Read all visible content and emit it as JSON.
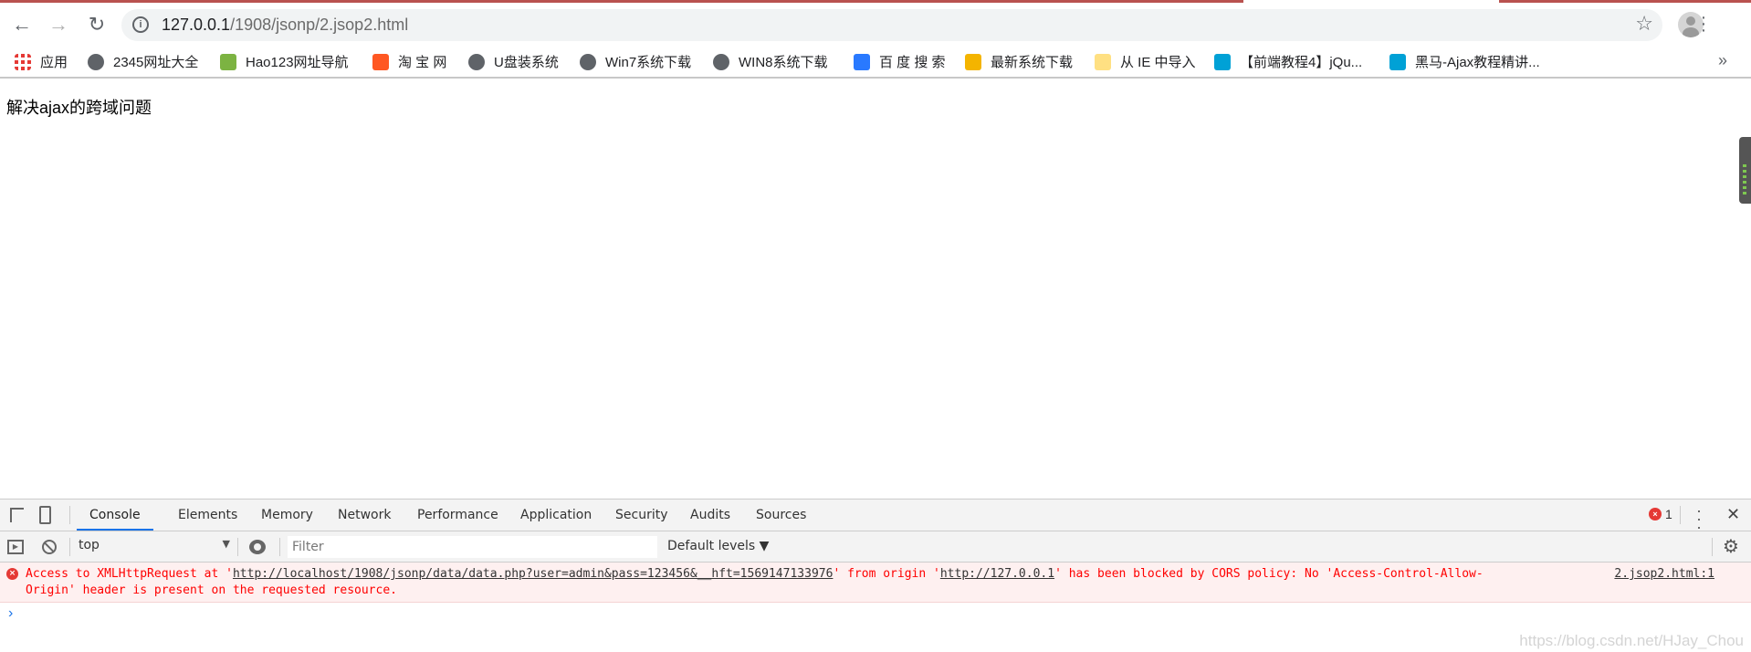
{
  "browser": {
    "url_host": "127.0.0.1",
    "url_path": "/1908/jsonp/2.jsop2.html",
    "bookmarks": [
      {
        "label": "应用",
        "icon": "apps-grid-icon"
      },
      {
        "label": "2345网址大全",
        "icon": "globe-icon"
      },
      {
        "label": "Hao123网址导航",
        "icon": "hao123-icon"
      },
      {
        "label": "淘 宝 网",
        "icon": "taobao-icon"
      },
      {
        "label": "U盘装系统",
        "icon": "globe-icon"
      },
      {
        "label": "Win7系统下载",
        "icon": "globe-icon"
      },
      {
        "label": "WIN8系统下载",
        "icon": "globe-icon"
      },
      {
        "label": "百 度 搜 索",
        "icon": "baidu-paw-icon"
      },
      {
        "label": "最新系统下载",
        "icon": "windows-logo-icon"
      },
      {
        "label": "从 IE 中导入",
        "icon": "folder-icon"
      },
      {
        "label": "【前端教程4】jQu...",
        "icon": "bilibili-icon"
      },
      {
        "label": "黑马-Ajax教程精讲...",
        "icon": "bilibili-icon"
      }
    ],
    "more_label": "»"
  },
  "page": {
    "heading": "解决ajax的跨域问题"
  },
  "devtools": {
    "tabs": [
      "Console",
      "Elements",
      "Memory",
      "Network",
      "Performance",
      "Application",
      "Security",
      "Audits",
      "Sources"
    ],
    "active_tab": "Console",
    "error_count": "1",
    "context": "top",
    "filter_placeholder": "Filter",
    "levels": "Default levels ▼",
    "error": {
      "pre": "Access to XMLHttpRequest at '",
      "link1": "http://localhost/1908/jsonp/data/data.php?user=admin&pass=123456&__hft=1569147133976",
      "mid": "' from origin '",
      "link2": "http://127.0.0.1",
      "post": "' has been blocked by CORS policy: No 'Access-Control-Allow-",
      "line2": "Origin' header is present on the requested resource.",
      "source": "2.jsop2.html:1"
    },
    "prompt": "›"
  },
  "watermark": "https://blog.csdn.net/HJay_Chou",
  "colors": {
    "error": "#ff0000",
    "error_bg": "#fef0f0",
    "accent": "#1a73e8"
  }
}
